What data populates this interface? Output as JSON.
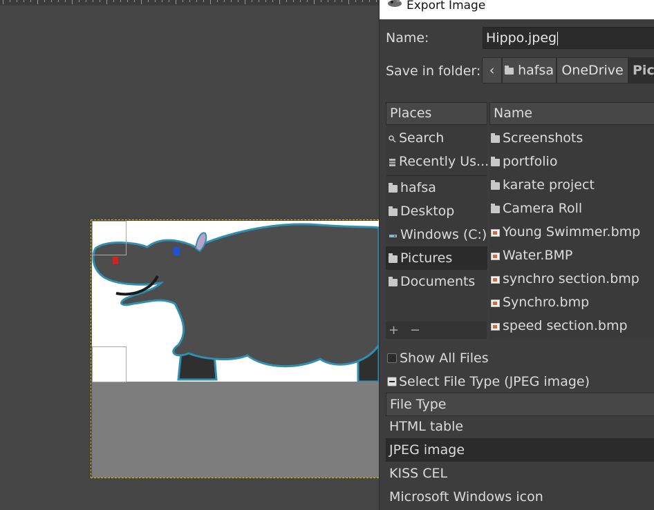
{
  "dialog": {
    "title": "Export Image",
    "name_label": "Name:",
    "name_value": "Hippo.jpeg",
    "folder_label": "Save in folder:",
    "breadcrumbs": [
      {
        "label": "‹"
      },
      {
        "label": "hafsa",
        "icon": "folder-icon"
      },
      {
        "label": "OneDrive"
      },
      {
        "label": "Pict"
      }
    ],
    "places": {
      "header": "Places",
      "items": [
        {
          "label": "Search",
          "icon": "search-icon"
        },
        {
          "label": "Recently Us...",
          "icon": "recent-icon"
        },
        {
          "label": "hafsa",
          "icon": "folder-icon"
        },
        {
          "label": "Desktop",
          "icon": "folder-icon"
        },
        {
          "label": "Windows (C:)",
          "icon": "drive-icon"
        },
        {
          "label": "Pictures",
          "icon": "folder-icon",
          "selected": true
        },
        {
          "label": "Documents",
          "icon": "folder-icon"
        }
      ],
      "add_label": "+",
      "remove_label": "−"
    },
    "files": {
      "header": "Name",
      "items": [
        {
          "label": "Screenshots",
          "icon": "folder-icon"
        },
        {
          "label": "portfolio",
          "icon": "folder-icon"
        },
        {
          "label": "karate project",
          "icon": "folder-icon"
        },
        {
          "label": "Camera Roll",
          "icon": "folder-icon"
        },
        {
          "label": "Young Swimmer.bmp",
          "icon": "image-file-icon"
        },
        {
          "label": "Water.BMP",
          "icon": "image-file-icon"
        },
        {
          "label": "synchro section.bmp",
          "icon": "image-file-icon"
        },
        {
          "label": "Synchro.bmp",
          "icon": "image-file-icon"
        },
        {
          "label": "speed section.bmp",
          "icon": "image-file-icon"
        }
      ]
    },
    "show_all_files": "Show All Files",
    "select_file_type": "Select File Type (JPEG image)",
    "file_type_header": "File Type",
    "file_types": [
      {
        "label": "HTML table"
      },
      {
        "label": "JPEG image",
        "selected": true
      },
      {
        "label": "KISS CEL"
      },
      {
        "label": "Microsoft Windows icon"
      }
    ]
  },
  "colors": {
    "workspace": "#454545",
    "dialog_bg": "#3d3d3d",
    "selection": "#2b2b2b",
    "canvas_border": "#d6c400",
    "hippo_body": "#4d4d4d",
    "hippo_outline": "#2f8fb0"
  }
}
